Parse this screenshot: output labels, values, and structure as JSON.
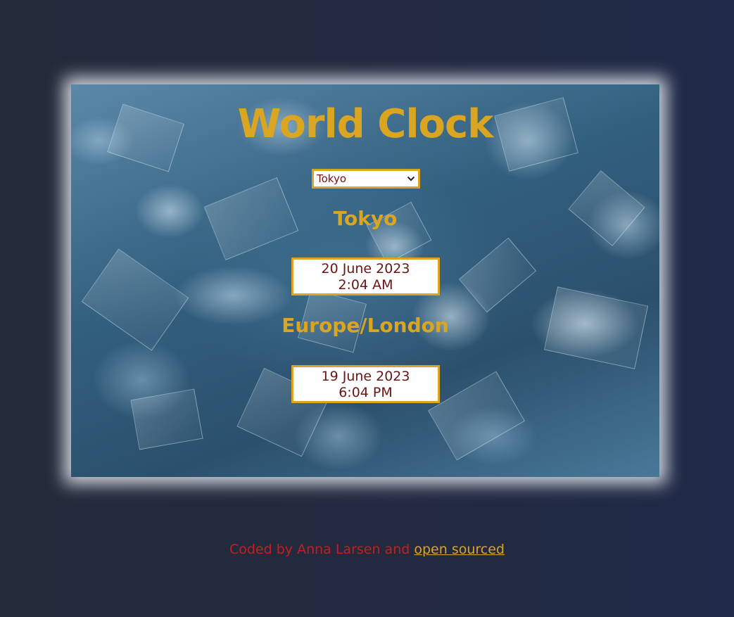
{
  "app": {
    "title": "World Clock"
  },
  "selector": {
    "selected": "Tokyo"
  },
  "clocks": [
    {
      "city": "Tokyo",
      "date": "20 June 2023",
      "time": "2:04 AM"
    },
    {
      "city": "Europe/London",
      "date": "19 June 2023",
      "time": "6:04 PM"
    }
  ],
  "footer": {
    "text": "Coded by Anna Larsen and ",
    "link_label": "open sourced"
  },
  "colors": {
    "accent": "#daa520",
    "footer_text": "#c41e1e",
    "time_text": "#6b1414",
    "background": "#232a40"
  },
  "icons": {
    "select_arrow": "chevron-down-icon"
  }
}
